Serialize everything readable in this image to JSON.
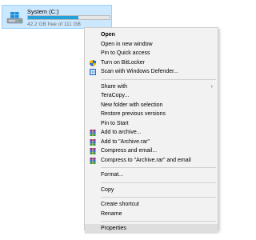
{
  "drive": {
    "name": "System (C:)",
    "free_text": "42.2 GB free of 111 GB",
    "used_fraction": 0.62
  },
  "menu": {
    "items": [
      {
        "label": "Open",
        "bold": true
      },
      {
        "label": "Open in new window"
      },
      {
        "label": "Pin to Quick access"
      },
      {
        "label": "Turn on BitLocker",
        "icon": "shield-icon"
      },
      {
        "label": "Scan with Windows Defender...",
        "icon": "defender-icon"
      },
      {
        "label": "Share with",
        "submenu": true
      },
      {
        "label": "TeraCopy..."
      },
      {
        "label": "New folder with selection"
      },
      {
        "label": "Restore previous versions"
      },
      {
        "label": "Pin to Start"
      },
      {
        "label": "Add to archive...",
        "icon": "winrar-icon"
      },
      {
        "label": "Add to \"Archive.rar\"",
        "icon": "winrar-icon"
      },
      {
        "label": "Compress and email...",
        "icon": "winrar-icon"
      },
      {
        "label": "Compress to \"Archive.rar\" and email",
        "icon": "winrar-icon"
      },
      {
        "label": "Format..."
      },
      {
        "label": "Copy"
      },
      {
        "label": "Create shortcut"
      },
      {
        "label": "Rename"
      },
      {
        "label": "Properties",
        "highlight": true
      }
    ],
    "submenu_arrow": "›"
  }
}
